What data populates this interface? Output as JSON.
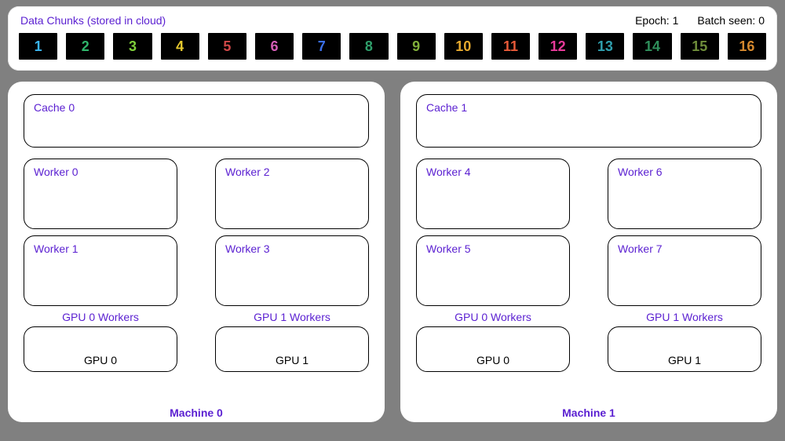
{
  "top": {
    "title": "Data Chunks (stored in cloud)",
    "epoch_label": "Epoch:",
    "epoch_value": "1",
    "batch_label": "Batch seen:",
    "batch_value": "0"
  },
  "chunks": [
    {
      "label": "1",
      "color": "#3bb5f0"
    },
    {
      "label": "2",
      "color": "#2fb66b"
    },
    {
      "label": "3",
      "color": "#7fcf3a"
    },
    {
      "label": "4",
      "color": "#e6c92e"
    },
    {
      "label": "5",
      "color": "#d04848"
    },
    {
      "label": "6",
      "color": "#d45db6"
    },
    {
      "label": "7",
      "color": "#3b6fe8"
    },
    {
      "label": "8",
      "color": "#2f9f6b"
    },
    {
      "label": "9",
      "color": "#7fae3a"
    },
    {
      "label": "10",
      "color": "#e6a92e"
    },
    {
      "label": "11",
      "color": "#e85a39"
    },
    {
      "label": "12",
      "color": "#e83a9a"
    },
    {
      "label": "13",
      "color": "#2f9fae"
    },
    {
      "label": "14",
      "color": "#2f8f5b"
    },
    {
      "label": "15",
      "color": "#6f8e3a"
    },
    {
      "label": "16",
      "color": "#d6892e"
    }
  ],
  "machines": [
    {
      "label": "Machine 0",
      "cache_label": "Cache 0",
      "gpus": [
        {
          "workers_label": "GPU 0 Workers",
          "gpu_label": "GPU 0",
          "workers": [
            "Worker 0",
            "Worker 1"
          ]
        },
        {
          "workers_label": "GPU 1 Workers",
          "gpu_label": "GPU 1",
          "workers": [
            "Worker 2",
            "Worker 3"
          ]
        }
      ]
    },
    {
      "label": "Machine 1",
      "cache_label": "Cache 1",
      "gpus": [
        {
          "workers_label": "GPU 0 Workers",
          "gpu_label": "GPU 0",
          "workers": [
            "Worker 4",
            "Worker 5"
          ]
        },
        {
          "workers_label": "GPU 1 Workers",
          "gpu_label": "GPU 1",
          "workers": [
            "Worker 6",
            "Worker 7"
          ]
        }
      ]
    }
  ]
}
